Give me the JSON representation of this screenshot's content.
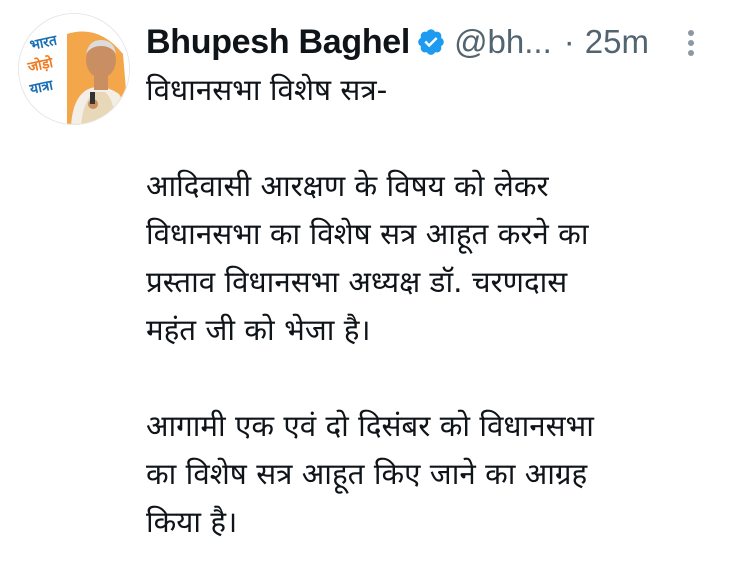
{
  "author": {
    "name": "Bhupesh Baghel",
    "handle": "@bh...",
    "separator": "·",
    "timestamp": "25m",
    "verified": true,
    "avatar_badge_lines": [
      "भारत",
      "जोड़ो",
      "यात्रा"
    ]
  },
  "tweet": {
    "paragraphs": [
      "विधानसभा विशेष सत्र-",
      "आदिवासी आरक्षण के विषय को लेकर\nविधानसभा का विशेष सत्र आहूत करने का\nप्रस्ताव विधानसभा अध्यक्ष डॉ. चरणदास\nमहंत जी को भेजा है।",
      "आगामी एक एवं दो दिसंबर को विधानसभा\nका विशेष सत्र आहूत किए जाने का आग्रह\nकिया है।"
    ]
  },
  "colors": {
    "verified": "#1d9bf0",
    "secondary_text": "#536471",
    "primary_text": "#0f1419",
    "badge_blue": "#1b6fb5",
    "badge_orange": "#f07a20"
  },
  "icons": {
    "verified": "verified-badge-icon",
    "more": "more-options-icon"
  }
}
